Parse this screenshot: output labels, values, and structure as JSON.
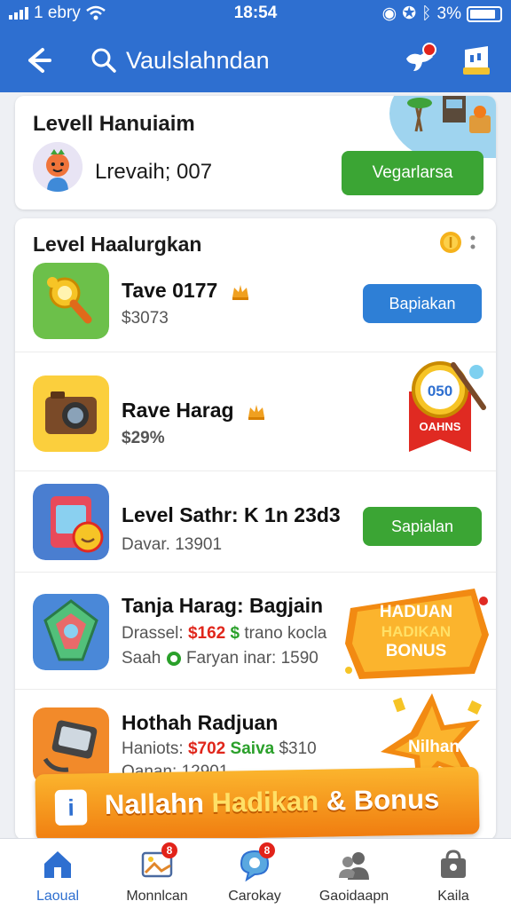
{
  "status": {
    "carrier": "1 ebry",
    "time": "18:54",
    "battery": "3%"
  },
  "header": {
    "search_text": "Vaulslahndan"
  },
  "profile_card": {
    "title": "Levell Hanuiaim",
    "level_text": "Lrevaih; 007",
    "button_label": "Vegarlarsa"
  },
  "list_card": {
    "title": "Level Haalurgkan",
    "items": [
      {
        "name": "Tave 0177",
        "sub": "$3073",
        "button": "Bapiakan"
      },
      {
        "name": "Rave Harag",
        "sub": "$29%",
        "badge_number": "050",
        "badge_label": "OAHNS"
      },
      {
        "name": "Level Sathr: K 1n 23d3",
        "sub": "Davar. 13901",
        "button": "Sapialan"
      },
      {
        "name": "Tanja Harag: Bagjain",
        "line1_label": "Drassel:",
        "line1_red": "$162",
        "line1_green": "$",
        "line1_rest": "trano kocla",
        "line2_label": "Saah",
        "line2_rest": "Faryan inar: 1590",
        "promo_lines": [
          "HADUAN",
          "HADIKAN",
          "BONUS"
        ]
      },
      {
        "name": "Hothah Radjuan",
        "line1_label": "Haniots:",
        "line1_red": "$702",
        "line1_green": "Saiva",
        "line1_rest": "$310",
        "line2_text": "Oanan: 12901",
        "burst_label": "Nilhan"
      }
    ]
  },
  "promo_banner": {
    "text_a": "Nallahn",
    "text_b": "Hadikan",
    "text_c": "& Bonus",
    "icon_letter": "i"
  },
  "nav": {
    "items": [
      {
        "label": "Laoual",
        "badge": ""
      },
      {
        "label": "Monnlcan",
        "badge": "8"
      },
      {
        "label": "Carokay",
        "badge": "8"
      },
      {
        "label": "Gaoidaapn",
        "badge": ""
      },
      {
        "label": "Kaila",
        "badge": ""
      }
    ]
  },
  "colors": {
    "header_blue": "#2e6fd0",
    "button_green": "#3ba534",
    "button_blue": "#2e7fd6",
    "badge_red": "#e2231a",
    "promo_orange": "#f59a1c"
  }
}
